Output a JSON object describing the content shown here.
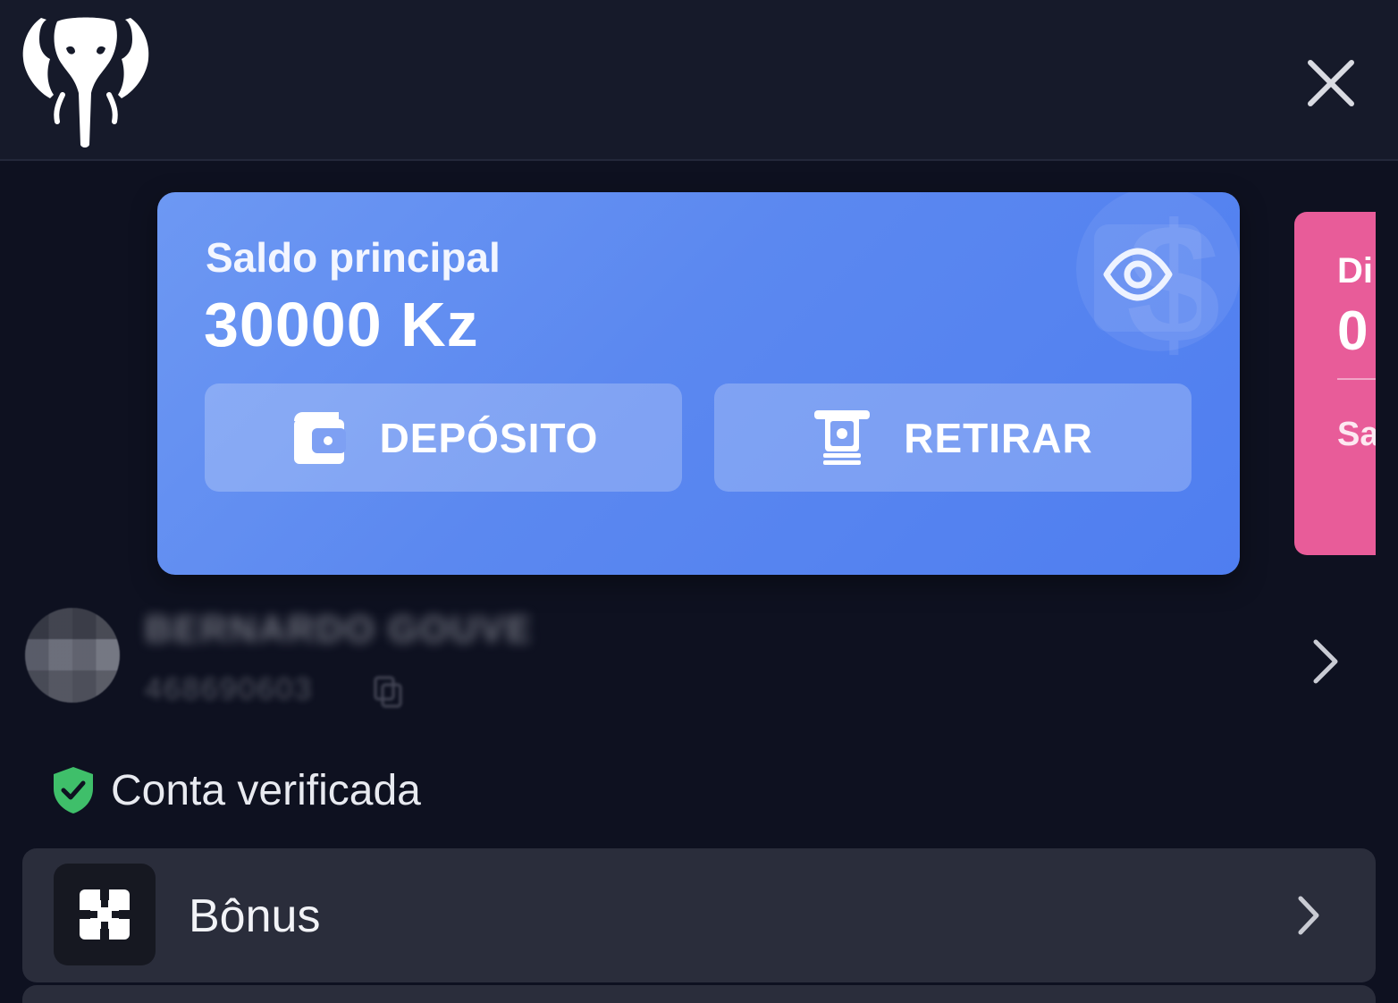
{
  "header": {
    "logo_icon": "elephant-logo-icon",
    "close_icon": "close-icon"
  },
  "balance_card": {
    "label": "Saldo principal",
    "amount": "30000 Kz",
    "toggle_icon": "eye-icon",
    "deposit_label": "DEPÓSITO",
    "deposit_icon": "wallet-icon",
    "withdraw_label": "RETIRAR",
    "withdraw_icon": "cash-withdraw-icon",
    "gradient_start": "#6d98f3",
    "gradient_end": "#4f7ef0"
  },
  "bonus_card_peek": {
    "title_partial": "Di",
    "amount_partial": "0",
    "sub_partial": "Sa",
    "color": "#e85c99"
  },
  "profile": {
    "name": "BERNARDO GOUVEIA",
    "id": "468690603",
    "copy_icon": "copy-icon",
    "chevron_icon": "chevron-right-icon"
  },
  "verification": {
    "label": "Conta verificada",
    "icon": "shield-check-icon",
    "color": "#3fbf6a"
  },
  "menu": {
    "items": [
      {
        "label": "Bônus",
        "icon": "bonus-gift-icon",
        "chevron": "chevron-right-icon"
      }
    ]
  }
}
